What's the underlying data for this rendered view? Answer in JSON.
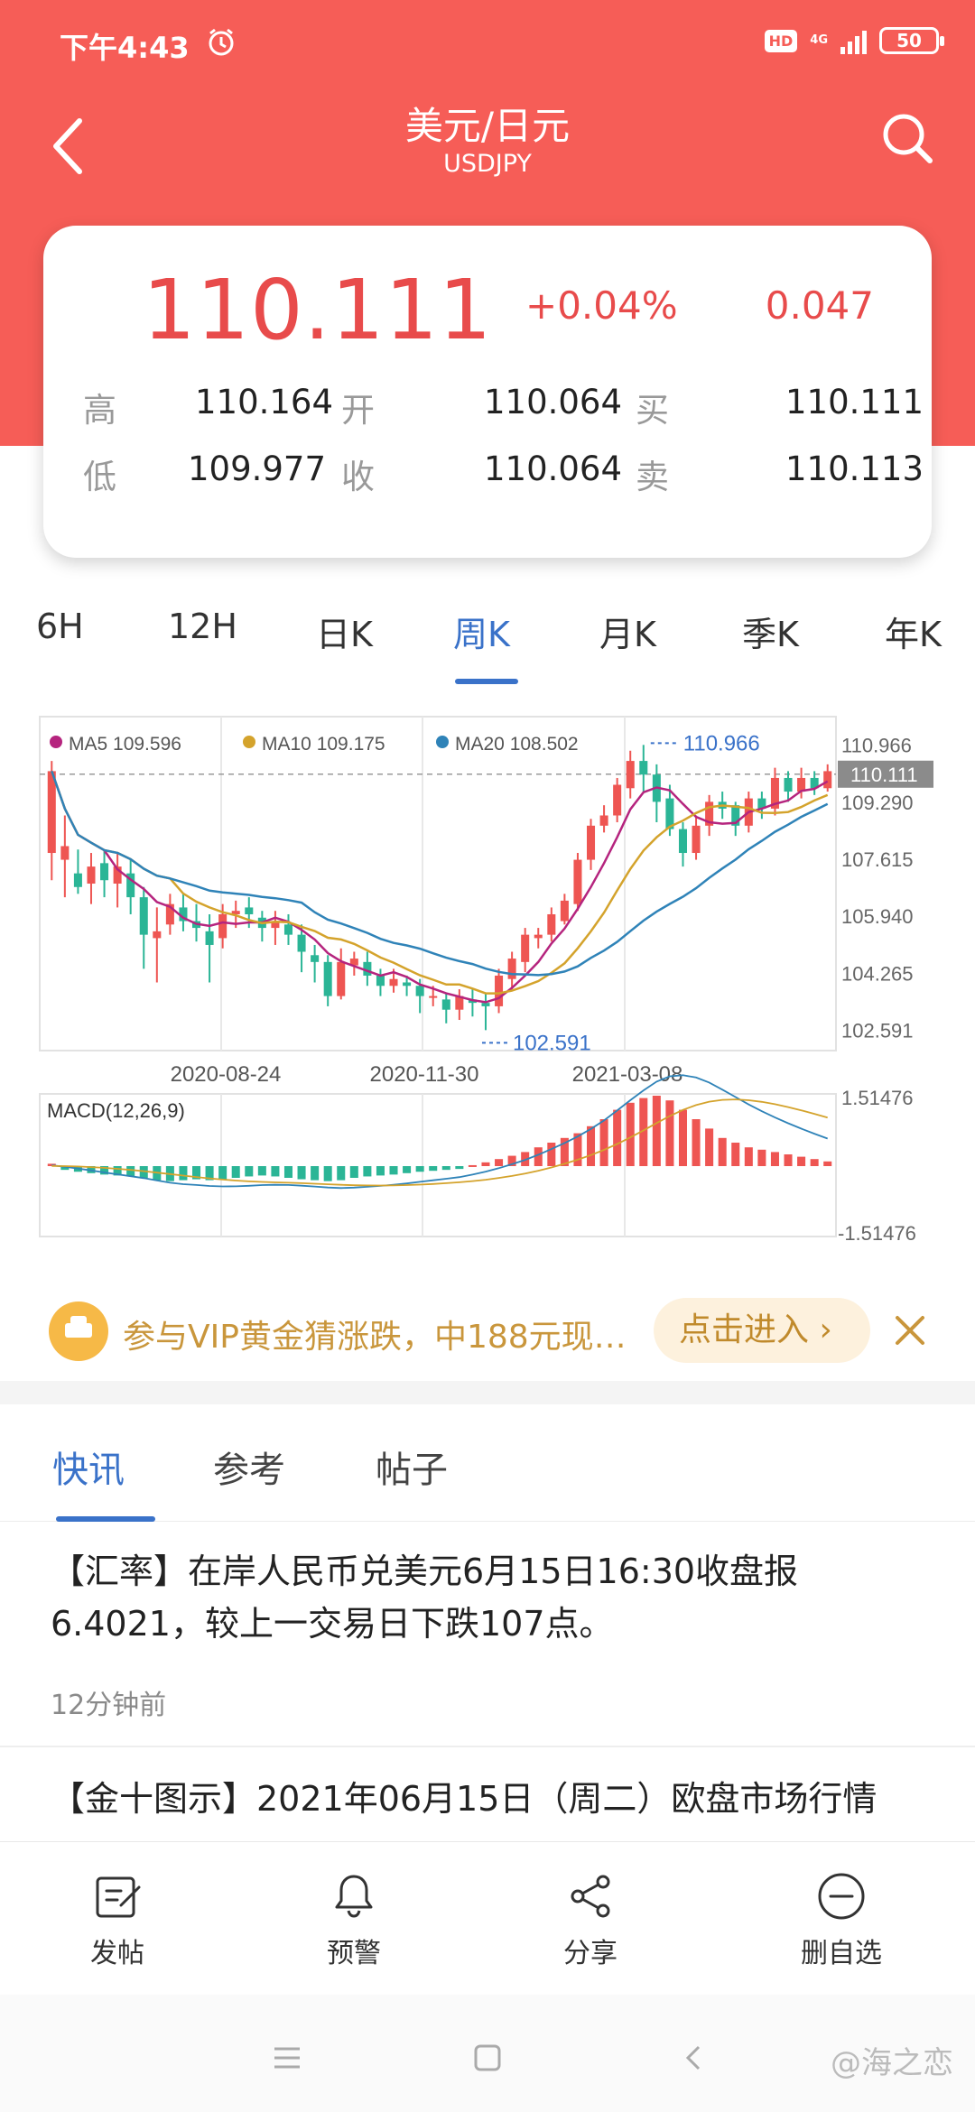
{
  "status_bar": {
    "time": "下午4:43",
    "hd": "HD",
    "network": "4G",
    "battery": "50"
  },
  "header": {
    "title": "美元/日元",
    "subtitle": "USDJPY"
  },
  "quote": {
    "price": "110.111",
    "change_pct": "+0.04%",
    "change": "0.047",
    "rows": [
      {
        "l1": "高",
        "v1": "110.164",
        "l2": "开",
        "v2": "110.064",
        "l3": "买",
        "v3": "110.111"
      },
      {
        "l1": "低",
        "v1": "109.977",
        "l2": "收",
        "v2": "110.064",
        "l3": "卖",
        "v3": "110.113"
      }
    ]
  },
  "period_tabs": [
    "6H",
    "12H",
    "日K",
    "周K",
    "月K",
    "季K",
    "年K"
  ],
  "active_period": "周K",
  "chart_data": [
    {
      "type": "candlestick",
      "legend": [
        {
          "name": "MA5 109.596",
          "color": "#b5247e"
        },
        {
          "name": "MA10 109.175",
          "color": "#d4a32c"
        },
        {
          "name": "MA20 108.502",
          "color": "#2f83b8"
        }
      ],
      "y_ticks": [
        "110.966",
        "109.290",
        "107.615",
        "105.940",
        "104.265",
        "102.591"
      ],
      "ylim": [
        102.0,
        111.8
      ],
      "x_ticks": [
        "2020-08-24",
        "2020-11-30",
        "2021-03-08"
      ],
      "current_price": "110.111",
      "max_label": "110.966",
      "min_label": "102.591",
      "candles": [
        [
          107.8,
          110.2,
          107.0,
          110.5
        ],
        [
          107.6,
          108.0,
          106.5,
          108.9
        ],
        [
          107.2,
          106.8,
          106.6,
          107.9
        ],
        [
          106.9,
          107.4,
          106.3,
          107.8
        ],
        [
          107.5,
          107.0,
          106.5,
          107.9
        ],
        [
          106.9,
          107.4,
          106.2,
          107.8
        ],
        [
          107.2,
          106.5,
          106.0,
          107.6
        ],
        [
          106.5,
          105.4,
          104.4,
          106.8
        ],
        [
          105.3,
          105.5,
          104.0,
          106.2
        ],
        [
          105.7,
          106.3,
          105.4,
          106.6
        ],
        [
          106.2,
          105.8,
          105.5,
          106.6
        ],
        [
          105.8,
          105.6,
          105.2,
          106.3
        ],
        [
          105.5,
          105.1,
          104.0,
          106.0
        ],
        [
          105.3,
          106.0,
          105.0,
          106.3
        ],
        [
          106.0,
          106.1,
          105.6,
          106.4
        ],
        [
          106.2,
          106.0,
          105.6,
          106.5
        ],
        [
          105.9,
          105.6,
          105.2,
          106.1
        ],
        [
          105.6,
          105.8,
          105.1,
          106.1
        ],
        [
          105.7,
          105.4,
          105.1,
          106.0
        ],
        [
          105.4,
          104.9,
          104.3,
          105.7
        ],
        [
          104.8,
          104.6,
          104.0,
          105.1
        ],
        [
          104.6,
          103.6,
          103.3,
          104.8
        ],
        [
          103.6,
          104.6,
          103.5,
          105.0
        ],
        [
          104.5,
          104.7,
          104.2,
          104.9
        ],
        [
          104.6,
          104.2,
          103.9,
          104.9
        ],
        [
          104.2,
          103.9,
          103.6,
          104.4
        ],
        [
          103.9,
          104.1,
          103.7,
          104.4
        ],
        [
          104.0,
          103.9,
          103.6,
          104.2
        ],
        [
          103.9,
          103.6,
          103.1,
          104.1
        ],
        [
          103.6,
          103.6,
          103.3,
          103.9
        ],
        [
          103.5,
          103.2,
          102.8,
          103.7
        ],
        [
          103.2,
          103.6,
          102.9,
          103.8
        ],
        [
          103.5,
          103.4,
          103.0,
          103.8
        ],
        [
          103.4,
          103.3,
          102.6,
          103.7
        ],
        [
          103.3,
          104.2,
          103.1,
          104.4
        ],
        [
          104.1,
          104.7,
          103.8,
          104.9
        ],
        [
          104.6,
          105.4,
          104.3,
          105.6
        ],
        [
          105.3,
          105.4,
          105.0,
          105.6
        ],
        [
          105.4,
          106.0,
          105.2,
          106.2
        ],
        [
          105.8,
          106.4,
          105.7,
          106.6
        ],
        [
          106.3,
          107.6,
          106.1,
          107.8
        ],
        [
          107.6,
          108.6,
          107.3,
          108.8
        ],
        [
          108.6,
          108.9,
          108.4,
          109.2
        ],
        [
          108.9,
          109.8,
          108.7,
          110.0
        ],
        [
          109.7,
          110.5,
          109.4,
          110.8
        ],
        [
          110.5,
          110.1,
          109.6,
          110.97
        ],
        [
          110.1,
          109.3,
          108.7,
          110.4
        ],
        [
          109.4,
          108.5,
          108.3,
          109.8
        ],
        [
          108.5,
          107.8,
          107.4,
          108.7
        ],
        [
          107.8,
          108.6,
          107.6,
          108.9
        ],
        [
          108.6,
          109.3,
          108.3,
          109.5
        ],
        [
          109.3,
          109.1,
          108.8,
          109.6
        ],
        [
          109.2,
          108.6,
          108.3,
          109.3
        ],
        [
          108.6,
          109.4,
          108.4,
          109.6
        ],
        [
          109.4,
          109.1,
          108.8,
          109.6
        ],
        [
          109.1,
          110.0,
          108.9,
          110.3
        ],
        [
          110.0,
          109.6,
          109.3,
          110.2
        ],
        [
          109.6,
          110.0,
          109.4,
          110.3
        ],
        [
          110.0,
          109.7,
          109.5,
          110.2
        ],
        [
          109.7,
          110.2,
          109.6,
          110.4
        ]
      ]
    },
    {
      "type": "bar",
      "legend": [
        {
          "name": "MACD(12,26,9)",
          "color": "#333333"
        }
      ],
      "y_ticks": [
        "1.51476",
        "-1.51476"
      ],
      "ylim": [
        -1.6,
        1.6
      ],
      "series": [
        {
          "name": "MACD",
          "values": [
            0.05,
            -0.08,
            -0.12,
            -0.15,
            -0.18,
            -0.2,
            -0.22,
            -0.25,
            -0.3,
            -0.32,
            -0.3,
            -0.28,
            -0.3,
            -0.28,
            -0.25,
            -0.22,
            -0.2,
            -0.22,
            -0.25,
            -0.28,
            -0.3,
            -0.32,
            -0.3,
            -0.25,
            -0.22,
            -0.2,
            -0.18,
            -0.15,
            -0.12,
            -0.1,
            -0.08,
            -0.06,
            0.02,
            0.08,
            0.15,
            0.22,
            0.3,
            0.4,
            0.5,
            0.6,
            0.7,
            0.85,
            1.0,
            1.2,
            1.35,
            1.45,
            1.5,
            1.4,
            1.2,
            1.0,
            0.8,
            0.6,
            0.5,
            0.4,
            0.35,
            0.3,
            0.25,
            0.2,
            0.15,
            0.1
          ]
        }
      ]
    }
  ],
  "promo": {
    "text": "参与VIP黄金猜涨跌，中188元现…",
    "button": "点击进入 ›"
  },
  "news_tabs": [
    "快讯",
    "参考",
    "帖子"
  ],
  "news": [
    {
      "text": "【汇率】在岸人民币兑美元6月15日16:30收盘报6.4021，较上一交易日下跌107点。",
      "time": "12分钟前"
    },
    {
      "text": "【金十图示】2021年06月15日（周二）欧盘市场行情"
    }
  ],
  "toolbar": {
    "post": "发帖",
    "alert": "预警",
    "share": "分享",
    "unfollow": "删自选"
  },
  "watermark": "@海之恋"
}
